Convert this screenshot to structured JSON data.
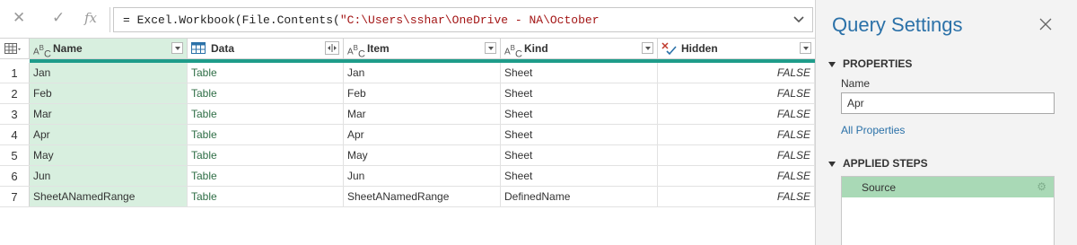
{
  "formula_bar": {
    "prefix": "= Excel.Workbook(File.Contents(",
    "path": "\"C:\\Users\\sshar\\OneDrive - NA\\October"
  },
  "columns": [
    {
      "type_icon": "ABC",
      "label": "Name"
    },
    {
      "type_icon": "table",
      "label": "Data"
    },
    {
      "type_icon": "ABC",
      "label": "Item"
    },
    {
      "type_icon": "ABC",
      "label": "Kind"
    },
    {
      "type_icon": "X✓",
      "label": "Hidden"
    }
  ],
  "rows": [
    {
      "index": "1",
      "name": "Jan",
      "data": "Table",
      "item": "Jan",
      "kind": "Sheet",
      "hidden": "FALSE"
    },
    {
      "index": "2",
      "name": "Feb",
      "data": "Table",
      "item": "Feb",
      "kind": "Sheet",
      "hidden": "FALSE"
    },
    {
      "index": "3",
      "name": "Mar",
      "data": "Table",
      "item": "Mar",
      "kind": "Sheet",
      "hidden": "FALSE"
    },
    {
      "index": "4",
      "name": "Apr",
      "data": "Table",
      "item": "Apr",
      "kind": "Sheet",
      "hidden": "FALSE"
    },
    {
      "index": "5",
      "name": "May",
      "data": "Table",
      "item": "May",
      "kind": "Sheet",
      "hidden": "FALSE"
    },
    {
      "index": "6",
      "name": "Jun",
      "data": "Table",
      "item": "Jun",
      "kind": "Sheet",
      "hidden": "FALSE"
    },
    {
      "index": "7",
      "name": "SheetANamedRange",
      "data": "Table",
      "item": "SheetANamedRange",
      "kind": "DefinedName",
      "hidden": "FALSE"
    }
  ],
  "query_settings": {
    "title": "Query Settings",
    "properties_header": "PROPERTIES",
    "name_label": "Name",
    "name_value": "Apr",
    "all_properties_link": "All Properties",
    "applied_steps_header": "APPLIED STEPS",
    "steps": [
      "Source"
    ]
  },
  "colors": {
    "accent_blue": "#2b71a8",
    "selected_column": "#d8efdf",
    "quality_bar": "#1e9c8a",
    "selected_step": "#a9d9b6"
  }
}
